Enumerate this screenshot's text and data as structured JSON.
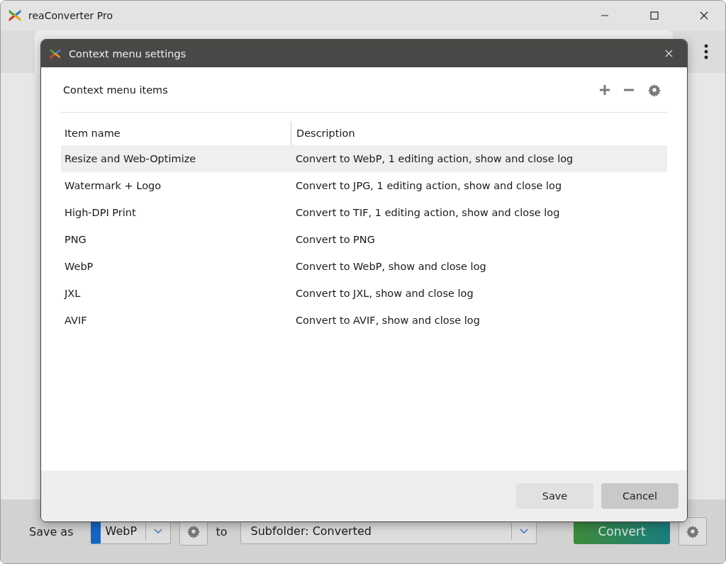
{
  "window": {
    "title": "reaConverter Pro"
  },
  "dialog": {
    "title": "Context menu settings",
    "section_label": "Context menu items",
    "columns": [
      "Item name",
      "Description"
    ],
    "rows": [
      {
        "name": "Resize and Web-Optimize",
        "description": "Convert to WebP, 1 editing action, show and close log",
        "selected": true
      },
      {
        "name": "Watermark + Logo",
        "description": "Convert to JPG, 1 editing action, show and close log",
        "selected": false
      },
      {
        "name": "High-DPI Print",
        "description": "Convert to TIF, 1 editing action, show and close log",
        "selected": false
      },
      {
        "name": "PNG",
        "description": "Convert to PNG",
        "selected": false
      },
      {
        "name": "WebP",
        "description": "Convert to WebP, show and close log",
        "selected": false
      },
      {
        "name": "JXL",
        "description": "Convert to JXL, show and close log",
        "selected": false
      },
      {
        "name": "AVIF",
        "description": "Convert to AVIF, show and close log",
        "selected": false
      }
    ],
    "buttons": [
      {
        "label": "Save",
        "kind": "secondary"
      },
      {
        "label": "Cancel",
        "kind": "primary"
      }
    ]
  },
  "bottom_bar": {
    "save_as_label": "Save as",
    "format": "WebP",
    "to_label": "to",
    "destination": "Subfolder: Converted",
    "convert_button": "Convert"
  }
}
